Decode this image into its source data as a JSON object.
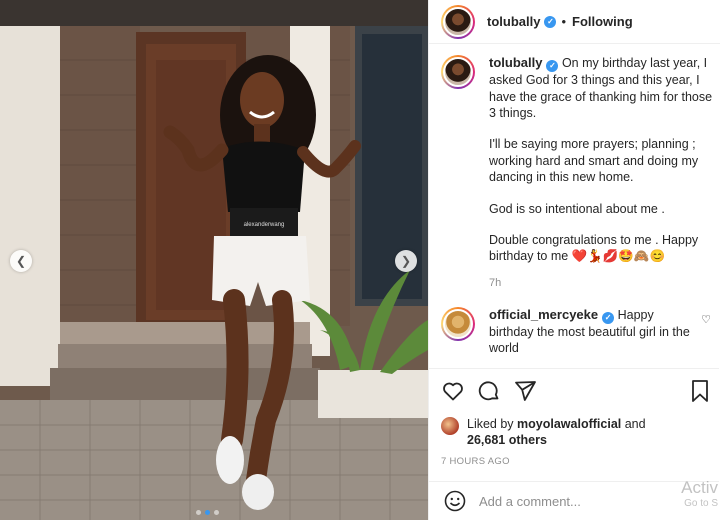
{
  "post": {
    "username": "tolubally",
    "follow_state": "Following",
    "separator": "•"
  },
  "caption": {
    "username": "tolubally",
    "paragraphs": [
      "On my birthday last year, I asked God for 3 things and this year, I have the grace of thanking him for those 3 things.",
      "I'll be saying more prayers; planning ; working hard and smart and doing my dancing in this new home.",
      "God is so intentional about me .",
      "Double congratulations to me . Happy birthday to me ❤️💃💋🤩🙈😊"
    ],
    "time": "7h"
  },
  "comment": {
    "username": "official_mercyeke",
    "text": "Happy birthday the most beautiful girl in the world"
  },
  "likes": {
    "prefix": "Liked by",
    "user": "moyolawalofficial",
    "joiner": "and",
    "others": "26,681 others"
  },
  "timestamp": "7 HOURS AGO",
  "add_comment": {
    "placeholder": "Add a comment..."
  },
  "photo": {
    "dots_total": 3,
    "dot_active_index": 1,
    "band_text": "alexanderwang"
  },
  "watermark": {
    "line1": "Activ",
    "line2": "Go to S"
  },
  "icons": {
    "verified": "verified-badge-icon",
    "heart": "heart-icon",
    "comment": "comment-icon",
    "share": "send-icon",
    "save": "bookmark-icon",
    "emoji": "smiley-icon"
  },
  "colors": {
    "accent": "#3897f0",
    "text": "#262626",
    "muted": "#8e8e8e"
  }
}
